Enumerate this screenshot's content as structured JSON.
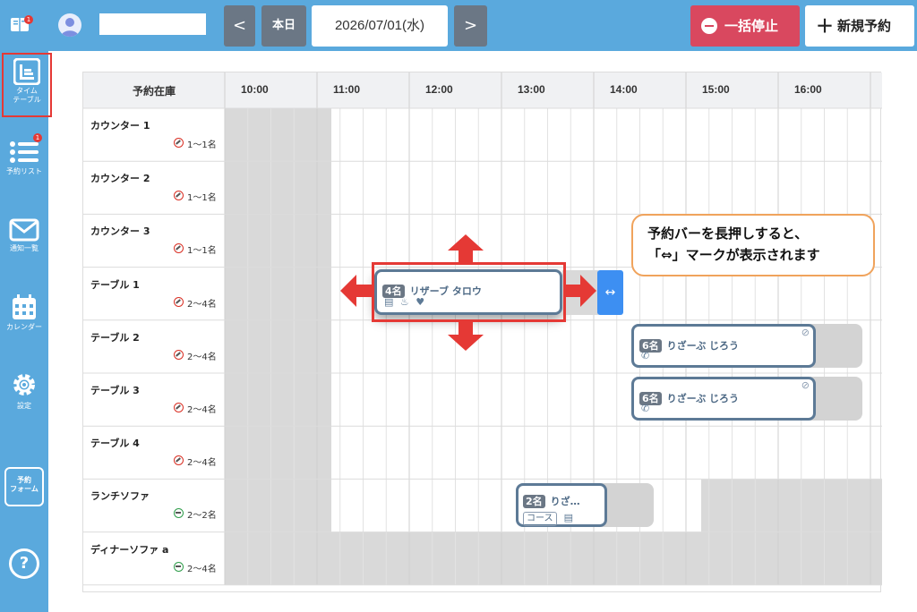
{
  "header": {
    "date": "2026/07/01(水)",
    "today_label": "本日",
    "prev_glyph": "<",
    "next_glyph": ">",
    "stop_all_label": "一括停止",
    "new_reservation_label": "新規予約",
    "notification_badge": "1"
  },
  "sidebar": {
    "items": [
      {
        "label": "タイム\nテーブル",
        "icon": "timetable-icon",
        "active": true
      },
      {
        "label": "予約リスト",
        "icon": "list-icon",
        "badge": "1"
      },
      {
        "label": "通知一覧",
        "icon": "mail-icon"
      },
      {
        "label": "カレンダー",
        "icon": "calendar-icon"
      },
      {
        "label": "設定",
        "icon": "gear-icon"
      },
      {
        "label": "予約\nフォーム",
        "icon": "form-icon"
      },
      {
        "label": "?",
        "icon": "help-icon"
      }
    ]
  },
  "table": {
    "corner_label": "予約在庫",
    "hours": [
      "10:00",
      "11:00",
      "12:00",
      "13:00",
      "14:00",
      "15:00",
      "16:00"
    ],
    "rows": [
      {
        "name": "カウンター 1",
        "capacity": "1〜1名",
        "smoking": "no-smoking"
      },
      {
        "name": "カウンター 2",
        "capacity": "1〜1名",
        "smoking": "no-smoking"
      },
      {
        "name": "カウンター 3",
        "capacity": "1〜1名",
        "smoking": "no-smoking"
      },
      {
        "name": "テーブル 1",
        "capacity": "2〜4名",
        "smoking": "no-smoking"
      },
      {
        "name": "テーブル 2",
        "capacity": "2〜4名",
        "smoking": "no-smoking"
      },
      {
        "name": "テーブル 3",
        "capacity": "2〜4名",
        "smoking": "no-smoking"
      },
      {
        "name": "テーブル 4",
        "capacity": "2〜4名",
        "smoking": "no-smoking"
      },
      {
        "name": "ランチソファ",
        "capacity": "2〜2名",
        "smoking": "smoking"
      },
      {
        "name": "ディナーソファ a",
        "capacity": "2〜4名",
        "smoking": "smoking"
      }
    ]
  },
  "reservations": [
    {
      "count": "4名",
      "name": "リザーブ タロウ",
      "row": "テーブル 1"
    },
    {
      "count": "6名",
      "name": "りざーぶ じろう",
      "row": "テーブル 2"
    },
    {
      "count": "6名",
      "name": "りざーぶ じろう",
      "row": "テーブル 3"
    },
    {
      "count": "2名",
      "name": "りざ…",
      "row": "ランチソファ",
      "tag": "コース"
    }
  ],
  "resize_handle_glyph": "↔",
  "callout": {
    "line1": "予約バーを長押しすると、",
    "line2": "「⇔」マークが表示されます"
  },
  "colors": {
    "bar": "#5aa9dd",
    "stop_button": "#d9485f",
    "reservation_border": "#5d7a96",
    "highlight_red": "#e53935",
    "handle_blue": "#3d8ff2",
    "callout_border": "#f0a35c",
    "closed_gray": "#d9d9d9"
  }
}
